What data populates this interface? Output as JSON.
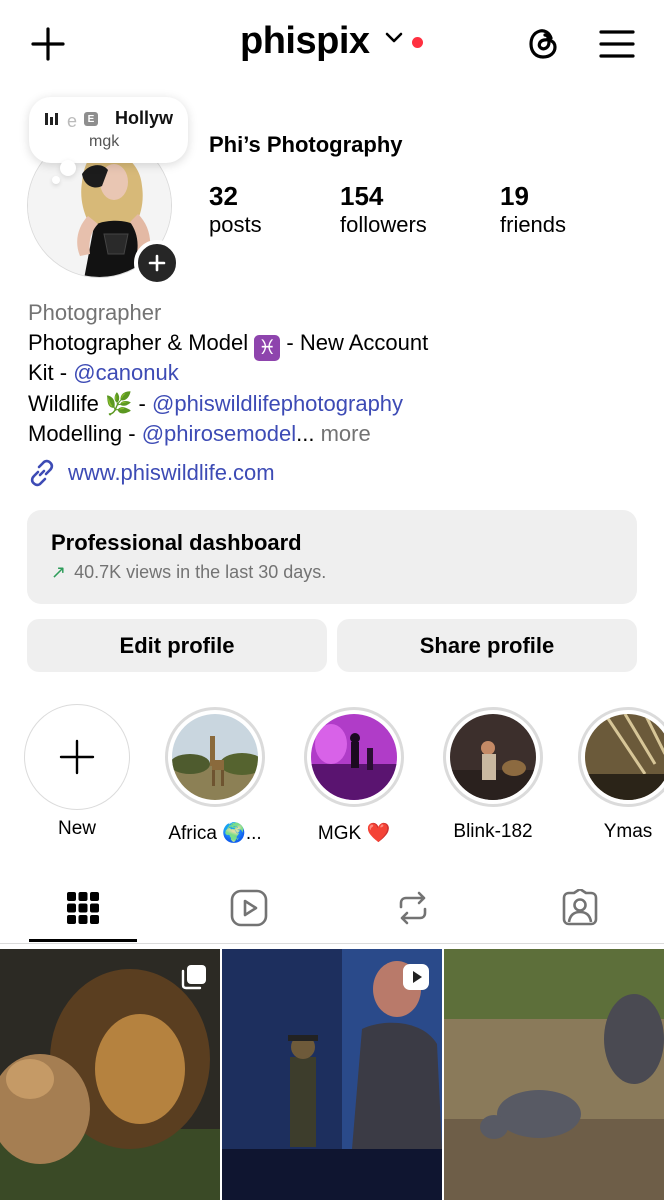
{
  "header": {
    "username": "phispix",
    "icons": [
      "plus-icon",
      "chevron-down-icon",
      "threads-icon",
      "menu-icon"
    ]
  },
  "note": {
    "title": "Hollyw",
    "prefix": "e",
    "explicit_badge": "E",
    "artist": "mgk"
  },
  "profile": {
    "display_name": "Phi’s Photography",
    "stats": [
      {
        "count": "32",
        "label": "posts"
      },
      {
        "count": "154",
        "label": "followers"
      },
      {
        "count": "19",
        "label": "friends"
      }
    ]
  },
  "bio": {
    "category": "Photographer",
    "line1_text": "Photographer & Model",
    "line1_emoji": "♓",
    "line1_suffix": " - New Account",
    "line2_prefix": "Kit - ",
    "line2_mention": "@canonuk",
    "line3_prefix": "Wildlife",
    "line3_emoji": "🌿",
    "line3_sep": " - ",
    "line3_mention": "@phiswildlifephotography",
    "line4_prefix": "Modelling - ",
    "line4_mention": "@phirosemodel",
    "line4_ellipsis": "...",
    "line4_more": " more",
    "website": "www.phiswildlife.com"
  },
  "dashboard": {
    "title": "Professional dashboard",
    "subtitle": "40.7K views in the last 30 days."
  },
  "actions": {
    "edit": "Edit profile",
    "share": "Share profile"
  },
  "highlights": [
    {
      "label": "New"
    },
    {
      "label": "Africa 🌍..."
    },
    {
      "label": "MGK ❤️"
    },
    {
      "label": "Blink-182"
    },
    {
      "label": "Ymas"
    }
  ],
  "tabs": [
    "grid-icon",
    "reels-icon",
    "reposts-icon",
    "tagged-icon"
  ],
  "colors": {
    "accent_link": "#3d4bb5",
    "notification_dot": "#ff3040",
    "muted_text": "#737373",
    "button_bg": "#efefef",
    "trend_green": "#2e9c5a"
  }
}
